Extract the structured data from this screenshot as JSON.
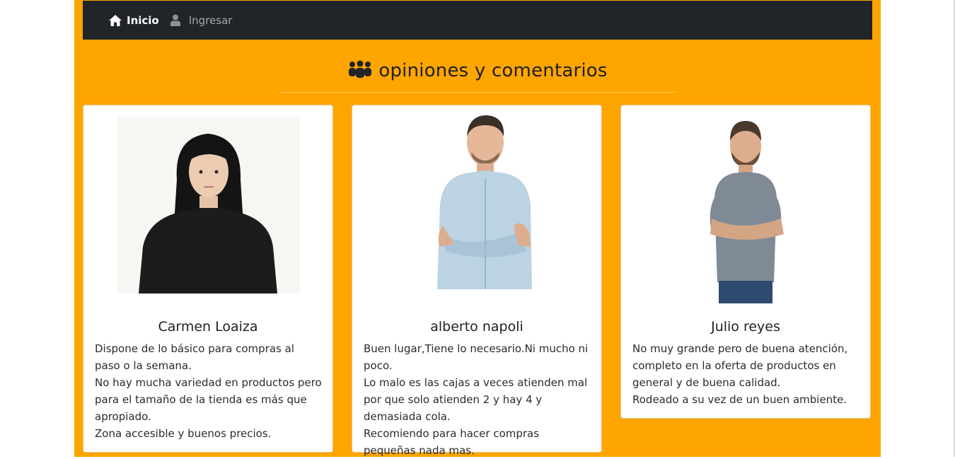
{
  "nav": {
    "home_label": "Inicio",
    "login_label": "Ingresar",
    "home_icon": "home-icon",
    "login_icon": "user-icon"
  },
  "section": {
    "title": "opiniones y comentarios",
    "icon": "users-group-icon"
  },
  "colors": {
    "page_background": "#ffa500",
    "navbar": "#212529",
    "card": "#ffffff"
  },
  "reviews": [
    {
      "name": "Carmen Loaiza",
      "lines": [
        "Dispone de lo básico para compras al paso o la semana.",
        "No hay mucha variedad en productos pero para el tamaño de la tienda es más que apropiado.",
        "Zona accesible y buenos precios."
      ]
    },
    {
      "name": "alberto napoli",
      "lines": [
        "Buen lugar,Tiene lo necesario.Ni mucho ni poco.",
        "Lo malo es las cajas a veces atienden mal por que solo atienden 2 y hay 4 y demasiada cola.",
        "Recomiendo para hacer compras pequeñas nada mas."
      ]
    },
    {
      "name": "Julio reyes",
      "lines": [
        "No muy grande pero de buena atención, completo en la oferta de productos en general y de buena calidad.",
        "Rodeado a su vez de un buen ambiente."
      ]
    }
  ]
}
